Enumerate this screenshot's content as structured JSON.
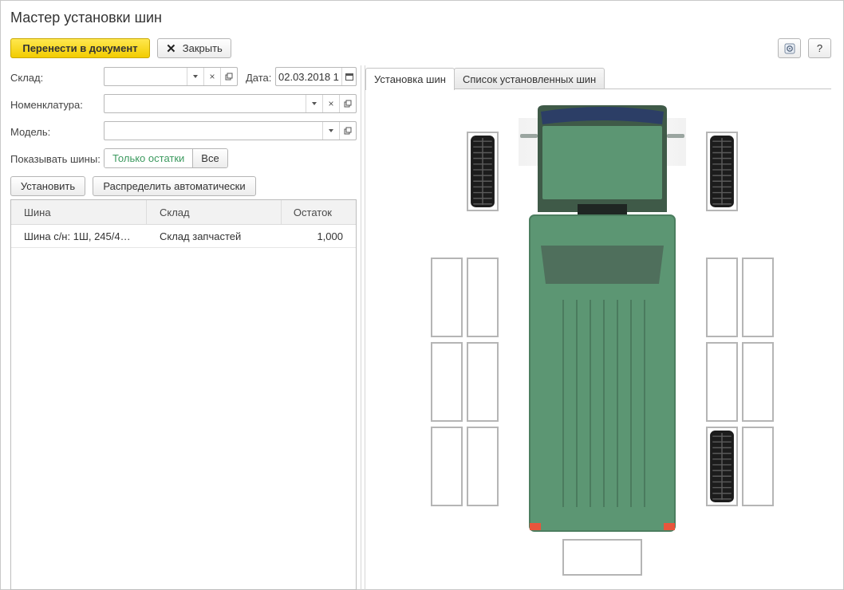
{
  "window": {
    "title": "Мастер установки шин"
  },
  "toolbar": {
    "transfer_label": "Перенести в документ",
    "close_label": "Закрыть",
    "help_label": "?"
  },
  "form": {
    "warehouse_label": "Склад:",
    "warehouse_value": "",
    "date_label": "Дата:",
    "date_value": "02.03.2018 1",
    "nomenclature_label": "Номенклатура:",
    "nomenclature_value": "",
    "model_label": "Модель:",
    "model_value": "",
    "show_tires_label": "Показывать шины:",
    "show_options": [
      "Только остатки",
      "Все"
    ],
    "show_selected": "Только остатки"
  },
  "actions": {
    "install_label": "Установить",
    "auto_distribute_label": "Распределить автоматически"
  },
  "table": {
    "columns": [
      "Шина",
      "Склад",
      "Остаток"
    ],
    "rows": [
      {
        "tire": "Шина с/н: 1Ш, 245/4…",
        "warehouse": "Склад запчастей",
        "balance": "1,000"
      }
    ]
  },
  "tabs": [
    {
      "label": "Установка шин",
      "active": true
    },
    {
      "label": "Список установленных шин",
      "active": false
    }
  ],
  "truck": {
    "body_color": "#5c9673",
    "cab_roof_color": "#2c3e66",
    "front_axle": {
      "left": "tire",
      "right": "tire"
    },
    "rear_axles": [
      {
        "left_outer": "empty",
        "left_inner": "empty",
        "right_inner": "empty",
        "right_outer": "empty"
      },
      {
        "left_outer": "empty",
        "left_inner": "empty",
        "right_inner": "empty",
        "right_outer": "empty"
      },
      {
        "left_outer": "empty",
        "left_inner": "empty",
        "right_inner": "tire",
        "right_outer": "empty"
      }
    ],
    "spare": "empty"
  }
}
